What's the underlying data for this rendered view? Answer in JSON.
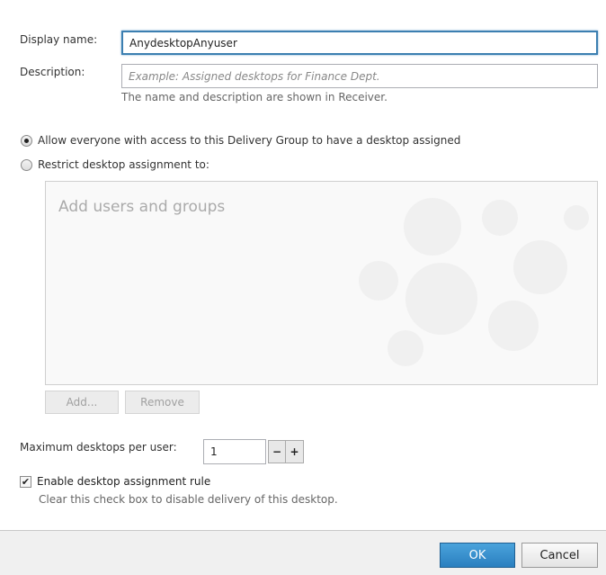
{
  "form": {
    "display_name_label": "Display name:",
    "display_name_value": "AnydesktopAnyuser",
    "description_label": "Description:",
    "description_placeholder": "Example: Assigned desktops for Finance Dept.",
    "name_hint": "The name and description are shown in Receiver."
  },
  "assignment": {
    "option_allow": "Allow everyone with access to this Delivery Group to have a desktop assigned",
    "option_restrict": "Restrict desktop assignment to:",
    "selected": "allow",
    "users_placeholder": "Add users and groups",
    "add_label": "Add...",
    "remove_label": "Remove"
  },
  "max_desktops": {
    "label": "Maximum desktops per user:",
    "value": "1",
    "decrement": "−",
    "increment": "+"
  },
  "rule": {
    "label": "Enable desktop assignment rule",
    "checked": true,
    "check_glyph": "✔",
    "hint": "Clear this check box to disable delivery of this desktop."
  },
  "footer": {
    "ok_label": "OK",
    "cancel_label": "Cancel"
  }
}
